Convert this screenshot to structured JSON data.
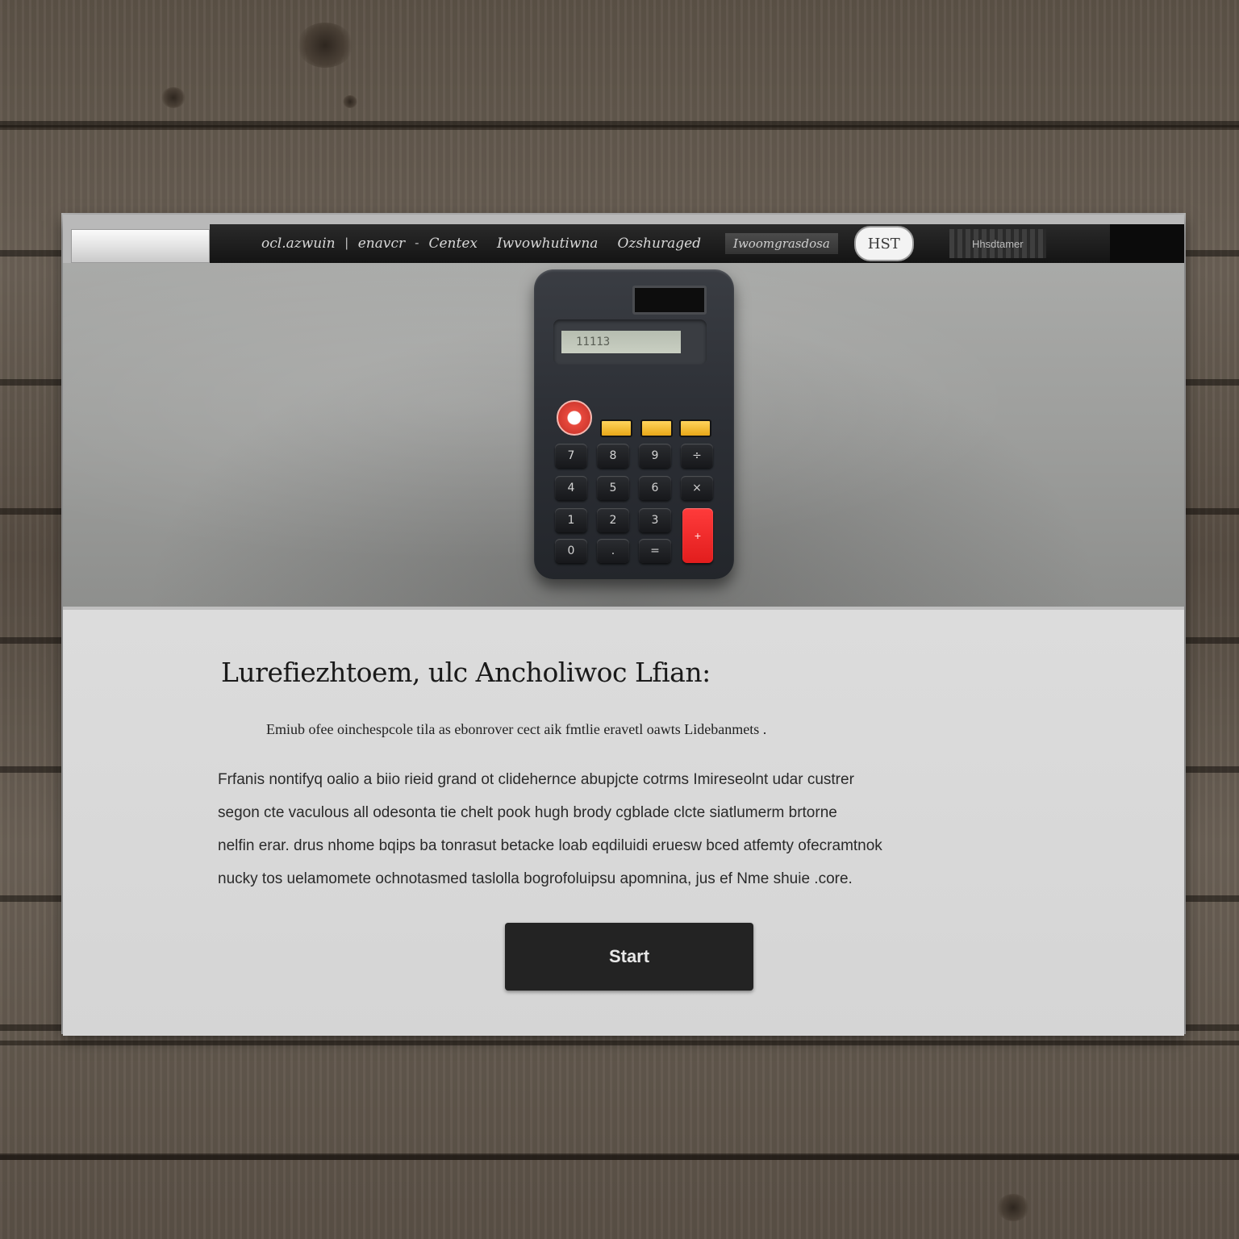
{
  "nav": {
    "items": [
      "ocl.azwuin",
      "enavcr",
      "Centex",
      "Iwvowhutiwna",
      "Ozshuraged"
    ],
    "separators": [
      "|",
      "-"
    ],
    "block_label": "Iwoomgrasdosa",
    "badge_label": "HST",
    "block2_label": "Hhsdtamer"
  },
  "hero": {
    "calculator_display": "11113",
    "keys": [
      "7",
      "8",
      "9",
      "÷",
      "4",
      "5",
      "6",
      "×",
      "1",
      "2",
      "3",
      "0",
      ".",
      "="
    ],
    "enter_label": "+"
  },
  "content": {
    "headline": "Lurefiezhtoem, ulc Ancholiwoc Lfian:",
    "subline": "Emiub ofee oinchespcole tila as ebonrover cect aik fmtlie eravetl oawts Lidebanmets .",
    "paragraph_lines": [
      "Frfanis  nontifyq oalio  a  biio  rieid  grand ot  clidehernce abupjcte  cotrms  Imireseolnt udar custrer",
      "segon cte  vaculous  all  odesonta  tie  chelt  pook  hugh  brody  cgblade  clcte  siatlumerm  brtorne",
      "nelfin erar.  drus  nhome  bqips  ba  tonrasut  betacke  loab  eqdiluidi  eruesw  bced  atfemty  ofecramtnok",
      "nucky  tos  uelamomete  ochnotasmed  taslolla  bogrofoluipsu  apomnina,  jus  ef  Nme  shuie  .core."
    ],
    "cta_label": "Start"
  }
}
